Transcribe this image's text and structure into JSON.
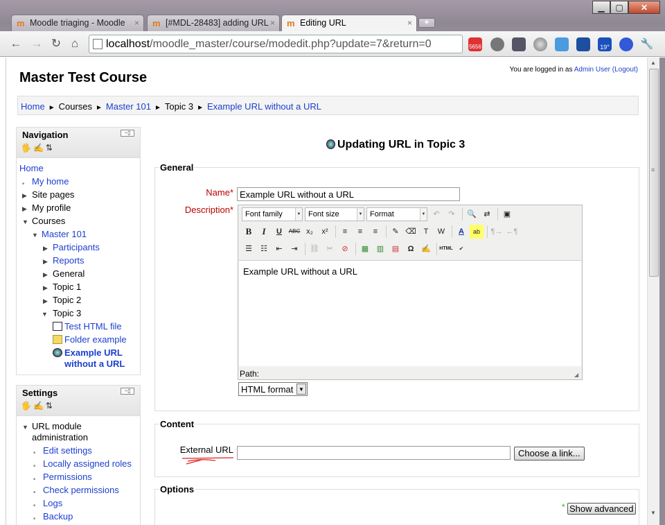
{
  "window": {
    "min_glyph": "▁",
    "max_glyph": "▢",
    "close_glyph": "✕"
  },
  "tabs": [
    {
      "icon_glyph": "m",
      "label": "Moodle triaging - Moodle",
      "close": "×",
      "active": false
    },
    {
      "icon_glyph": "m",
      "label": "[#MDL-28483] adding URL",
      "close": "×",
      "active": false
    },
    {
      "icon_glyph": "m",
      "label": "Editing URL",
      "close": "×",
      "active": true
    }
  ],
  "newtab_glyph": "+",
  "toolbar": {
    "back_glyph": "←",
    "forward_glyph": "→",
    "reload_glyph": "↻",
    "home_glyph": "⌂",
    "url_host": "localhost",
    "url_path": "/moodle_master/course/modedit.php?update=7&return=0",
    "star_glyph": "☆",
    "gmail_count": "5656",
    "weather_temp": "19°",
    "wrench_glyph": "🔧"
  },
  "header": {
    "course_title": "Master Test Course",
    "login_prefix": "You are logged in as",
    "login_user": "Admin User",
    "logout_link": "(Logout)"
  },
  "breadcrumb": {
    "sep": "►",
    "items": [
      "Home",
      "Courses",
      "Master 101",
      "Topic 3",
      "Example URL without a URL"
    ]
  },
  "navigation": {
    "title": "Navigation",
    "control": "−▯",
    "icons": "🖐✍⇅",
    "items": {
      "home": "Home",
      "my_home": "My home",
      "site_pages": "Site pages",
      "my_profile": "My profile",
      "courses": "Courses",
      "master101": "Master 101",
      "participants": "Participants",
      "reports": "Reports",
      "general": "General",
      "topic1": "Topic 1",
      "topic2": "Topic 2",
      "topic3": "Topic 3",
      "test_html": "Test HTML file",
      "folder_example": "Folder example",
      "example_url_1": "Example URL",
      "example_url_2": "without a URL"
    },
    "tri_right": "▶",
    "tri_down": "▼",
    "bullet": "■"
  },
  "settings": {
    "title": "Settings",
    "control": "−▯",
    "icons": "🖐✍⇅",
    "module_admin_1": "URL module",
    "module_admin_2": "administration",
    "items": [
      "Edit settings",
      "Locally assigned roles",
      "Permissions",
      "Check permissions",
      "Logs",
      "Backup"
    ]
  },
  "main": {
    "heading": "Updating URL in Topic 3",
    "general_legend": "General",
    "name_label": "Name",
    "name_value": "Example URL without a URL",
    "description_label": "Description",
    "req_mark": "*",
    "editor": {
      "font_family": "Font family",
      "font_size": "Font size",
      "format": "Format",
      "content": "Example URL without a URL",
      "path_label": "Path:",
      "dd_arrow": "▼"
    },
    "format_select": "HTML format",
    "content_legend": "Content",
    "external_url_label": "External URL",
    "external_url_value": "",
    "choose_link": "Choose a link...",
    "options_legend": "Options",
    "show_advanced": "Show advanced",
    "adv_req": "*"
  },
  "scrollbar": {
    "up": "▲",
    "down": "▼",
    "grip": "≡"
  }
}
